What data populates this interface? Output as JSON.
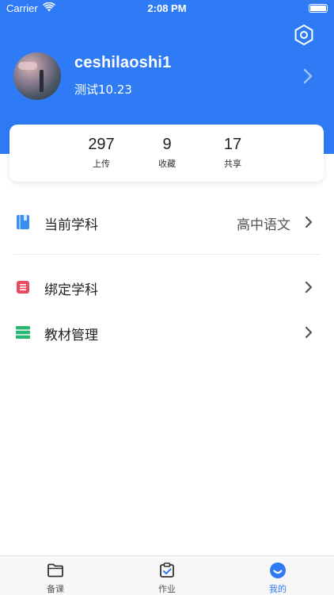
{
  "status_bar": {
    "carrier": "Carrier",
    "time": "2:08 PM"
  },
  "profile": {
    "username": "ceshilaoshi1",
    "subtitle": "测试10.23"
  },
  "stats": [
    {
      "value": "297",
      "label": "上传"
    },
    {
      "value": "9",
      "label": "收藏"
    },
    {
      "value": "17",
      "label": "共享"
    }
  ],
  "menu": {
    "current_subject": {
      "label": "当前学科",
      "value": "高中语文"
    },
    "bind_subject": {
      "label": "绑定学科"
    },
    "textbook_manage": {
      "label": "教材管理"
    }
  },
  "tabs": [
    {
      "label": "备课",
      "active": false
    },
    {
      "label": "作业",
      "active": false
    },
    {
      "label": "我的",
      "active": true
    }
  ],
  "colors": {
    "primary": "#2f7bf6",
    "book_icon": "#3b8df0",
    "list_icon": "#e84a5f",
    "stack_icon": "#2bb673"
  }
}
